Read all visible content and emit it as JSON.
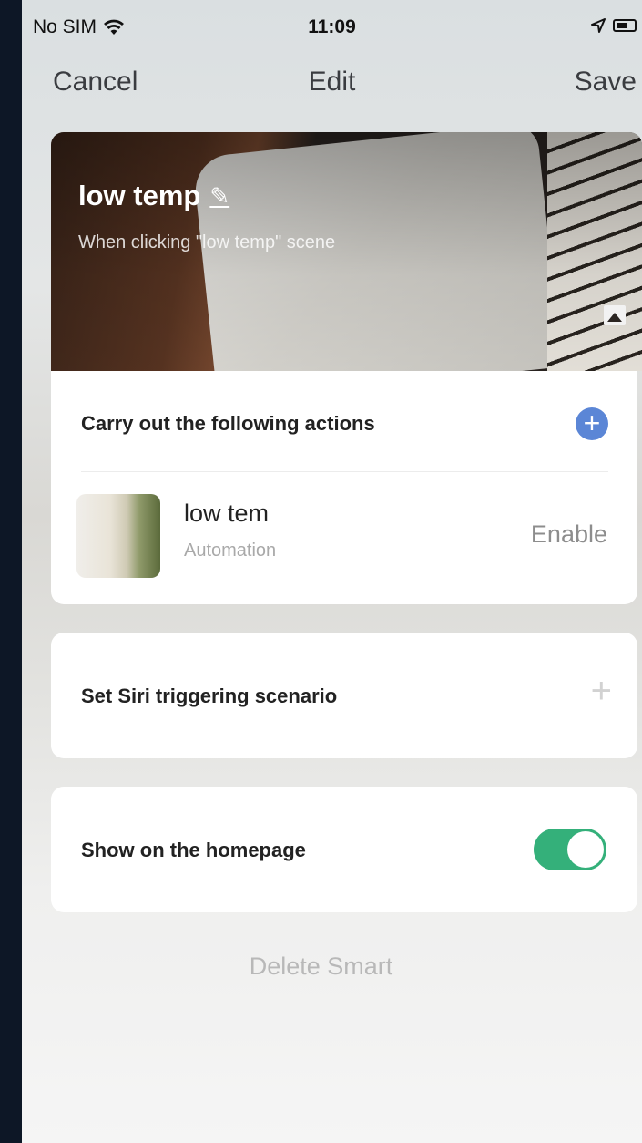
{
  "status_bar": {
    "carrier": "No SIM",
    "time": "11:09"
  },
  "nav": {
    "cancel_label": "Cancel",
    "title": "Edit",
    "save_label": "Save"
  },
  "scene": {
    "name": "low temp",
    "subtitle": "When clicking \"low temp\" scene"
  },
  "actions_section": {
    "heading": "Carry out the following actions",
    "items": [
      {
        "name": "low tem",
        "type": "Automation",
        "state": "Enable"
      }
    ]
  },
  "siri_section": {
    "label": "Set Siri triggering scenario"
  },
  "homepage_section": {
    "label": "Show on the homepage",
    "toggle_on": true,
    "toggle_color": "#34b07a"
  },
  "delete_label": "Delete Smart",
  "colors": {
    "accent_blue": "#5b86d6",
    "toggle_green": "#34b07a"
  }
}
